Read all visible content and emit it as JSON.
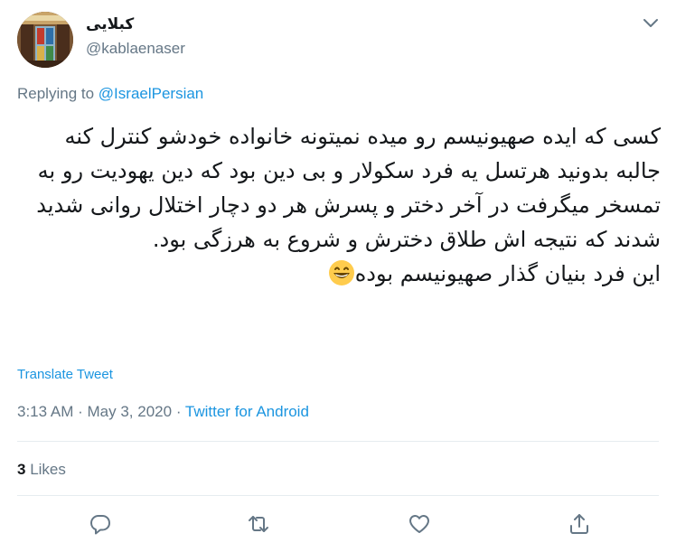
{
  "author": {
    "display_name": "کبلایی",
    "handle": "@kablaenaser"
  },
  "reply": {
    "prefix": "Replying to",
    "mention": "@IsraelPersian"
  },
  "tweet": {
    "lines": [
      "کسی که ایده صهیونیسم رو میده نمیتونه خانواده خودشو کنترل کنه",
      "جالبه بدونید هرتسل یه فرد سکولار و بی دین بود که دین یهودیت رو به تمسخر میگرفت در آخر دختر و پسرش هر دو دچار اختلال روانی شدید شدند که نتیجه اش طلاق دخترش و شروع به هرزگی بود.",
      "این فرد بنیان گذار صهیونیسم بوده"
    ],
    "emoji": "grinning-face-emoji"
  },
  "translate_label": "Translate Tweet",
  "meta": {
    "time": "3:13 AM",
    "separator": "·",
    "date": "May 3, 2020",
    "source": "Twitter for Android"
  },
  "stats": {
    "likes_count": "3",
    "likes_label": "Likes"
  },
  "actions": {
    "reply_icon": "reply-icon",
    "retweet_icon": "retweet-icon",
    "like_icon": "heart-icon",
    "share_icon": "share-icon"
  },
  "colors": {
    "accent": "#1b95e0",
    "secondary_text": "#657786",
    "divider": "#e6ecf0"
  }
}
